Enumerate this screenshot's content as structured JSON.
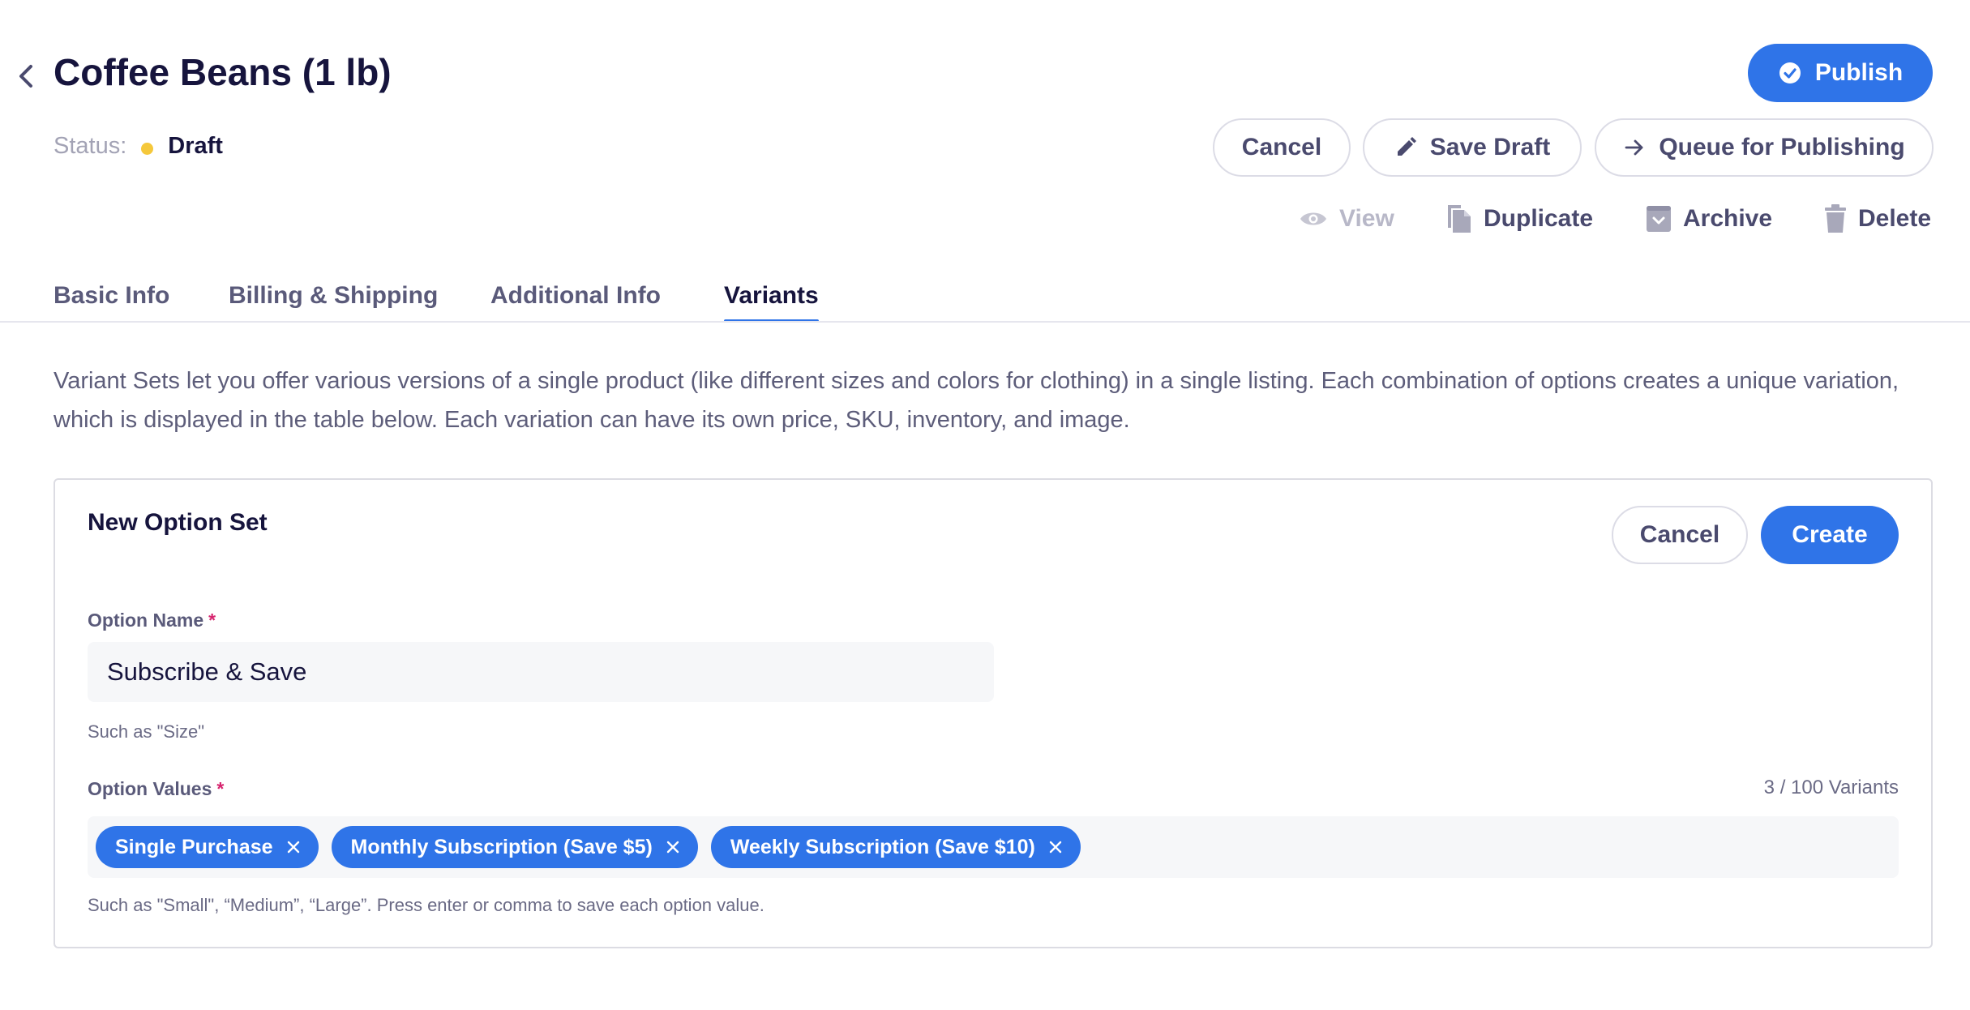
{
  "header": {
    "title": "Coffee Beans (1 lb)",
    "status_label": "Status:",
    "status_value": "Draft",
    "status_color": "#f5c83b"
  },
  "actions": {
    "publish": "Publish",
    "cancel": "Cancel",
    "save_draft": "Save Draft",
    "queue": "Queue for Publishing",
    "view": "View",
    "duplicate": "Duplicate",
    "archive": "Archive",
    "delete": "Delete"
  },
  "tabs": [
    {
      "label": "Basic Info",
      "active": false
    },
    {
      "label": "Billing & Shipping",
      "active": false
    },
    {
      "label": "Additional Info",
      "active": false
    },
    {
      "label": "Variants",
      "active": true
    }
  ],
  "description": "Variant Sets let you offer various versions of a single product (like different sizes and colors for clothing) in a single listing. Each combination of options creates a unique variation, which is displayed in the table below. Each variation can have its own price, SKU, inventory, and image.",
  "option_set": {
    "title": "New Option Set",
    "cancel": "Cancel",
    "create": "Create",
    "option_name_label": "Option Name",
    "required_mark": "*",
    "option_name_value": "Subscribe & Save",
    "option_name_hint": "Such as \"Size\"",
    "option_values_label": "Option Values",
    "variant_count": "3 / 100 Variants",
    "values": [
      "Single Purchase",
      "Monthly Subscription (Save $5)",
      "Weekly Subscription (Save $10)"
    ],
    "option_values_hint": "Such as \"Small\", “Medium”, “Large”. Press enter or comma to save each option value."
  },
  "colors": {
    "accent": "#2f74e8",
    "required": "#d6246e",
    "text_dark": "#16143d",
    "text_muted": "#5a5a7a"
  },
  "icons": {
    "back": "chevron-left-icon",
    "publish": "check-circle-icon",
    "save_draft": "pencil-icon",
    "queue": "arrow-right-icon",
    "view": "eye-icon",
    "duplicate": "copy-icon",
    "archive": "archive-icon",
    "delete": "trash-icon",
    "chip_remove": "close-icon"
  }
}
